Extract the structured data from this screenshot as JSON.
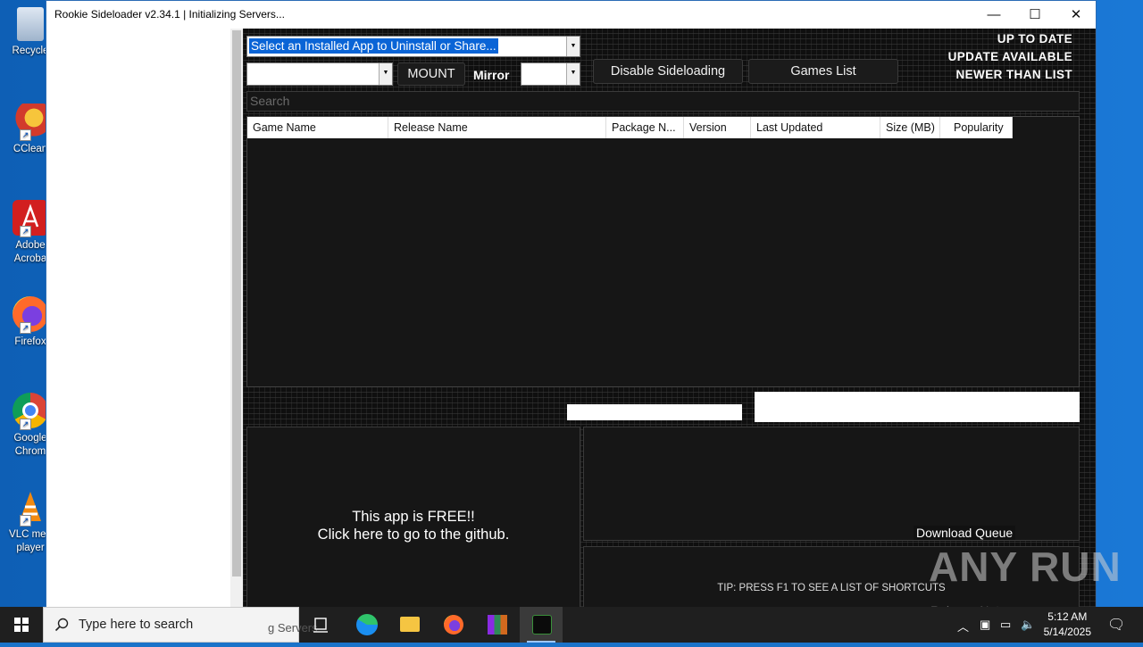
{
  "desktop": {
    "icons": [
      {
        "label": "Recycle",
        "icon": "recycle-bin-icon"
      },
      {
        "label": "CClean",
        "icon": "ccleaner-icon"
      },
      {
        "label": "Adobe\nAcroba",
        "icon": "adobe-acrobat-icon"
      },
      {
        "label": "Firefox",
        "icon": "firefox-icon"
      },
      {
        "label": "Google\nChrom",
        "icon": "chrome-icon"
      },
      {
        "label": "VLC med\nplayer",
        "icon": "vlc-icon"
      }
    ]
  },
  "window": {
    "title": "Rookie Sideloader v2.34.1 | Initializing Servers...",
    "minimize": "—",
    "maximize": "☐",
    "close": "✕"
  },
  "app": {
    "installed_apps_combo": "Select an Installed App to Uninstall or Share...",
    "device_combo_value": "",
    "mount_button": "MOUNT",
    "mirror_label": "Mirror",
    "mirror_value": "",
    "disable_sideloading_button": "Disable Sideloading",
    "games_list_button": "Games List",
    "status_legend": [
      "UP TO DATE",
      "UPDATE AVAILABLE",
      "NEWER THAN LIST"
    ],
    "search_placeholder": "Search",
    "columns": [
      "Game Name",
      "Release Name",
      "Package N...",
      "Version",
      "Last Updated",
      "Size (MB)",
      "Popularity"
    ],
    "free_line1": "This app is FREE!!",
    "free_line2": "Click here to go to the github.",
    "download_queue_label": "Download Queue",
    "tip": "TIP: PRESS F1 TO SEE A LIST OF SHORTCUTS",
    "release_notes_label": "Release Notes",
    "status_ghost_text": "g Servers"
  },
  "watermark": "ANY RUN",
  "taskbar": {
    "search_placeholder": "Type here to search",
    "time": "5:12 AM",
    "date": "5/14/2025"
  },
  "colors": {
    "accent": "#0a64d6",
    "app_bg": "#0f0f0f",
    "panel_bg": "#161616"
  }
}
